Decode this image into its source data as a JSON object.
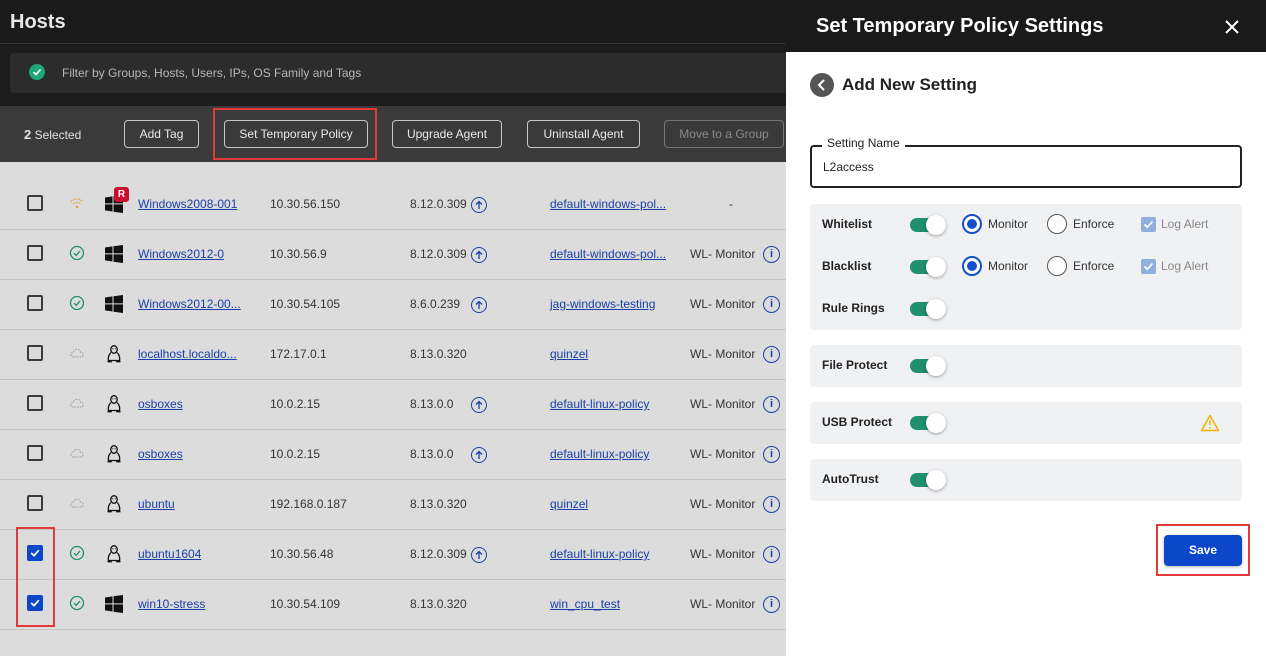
{
  "page": {
    "title": "Hosts"
  },
  "filter": {
    "placeholder": "Filter by Groups, Hosts, Users, IPs, OS Family and Tags"
  },
  "actionbar": {
    "selected_count": "2",
    "selected_label": "Selected",
    "add_tag": "Add Tag",
    "set_temp_policy": "Set Temporary Policy",
    "upgrade_agent": "Upgrade Agent",
    "uninstall_agent": "Uninstall Agent",
    "move_to_group": "Move to a Group"
  },
  "rows": [
    {
      "checked": false,
      "status": "wifi",
      "os": "windows",
      "badge": "R",
      "host": "Windows2008-001",
      "ip": "10.30.56.150",
      "version": "8.12.0.309",
      "upgrade": true,
      "policy": "default-windows-pol...",
      "mode": "",
      "dash": "-"
    },
    {
      "checked": false,
      "status": "ok",
      "os": "windows",
      "host": "Windows2012-0",
      "ip": "10.30.56.9",
      "version": "8.12.0.309",
      "upgrade": true,
      "policy": "default-windows-pol...",
      "mode": "WL- Monitor",
      "dash": ""
    },
    {
      "checked": false,
      "status": "ok",
      "os": "windows",
      "host": "Windows2012-00...",
      "ip": "10.30.54.105",
      "version": "8.6.0.239",
      "upgrade": true,
      "policy": "jag-windows-testing",
      "mode": "WL- Monitor",
      "dash": ""
    },
    {
      "checked": false,
      "status": "cloud",
      "os": "linux",
      "host": "localhost.localdo...",
      "ip": "172.17.0.1",
      "version": "8.13.0.320",
      "upgrade": false,
      "policy": "quinzel",
      "mode": "WL- Monitor",
      "dash": ""
    },
    {
      "checked": false,
      "status": "cloud",
      "os": "linux",
      "host": "osboxes",
      "ip": "10.0.2.15",
      "version": "8.13.0.0",
      "upgrade": true,
      "policy": "default-linux-policy",
      "mode": "WL- Monitor",
      "dash": ""
    },
    {
      "checked": false,
      "status": "cloud",
      "os": "linux",
      "host": "osboxes",
      "ip": "10.0.2.15",
      "version": "8.13.0.0",
      "upgrade": true,
      "policy": "default-linux-policy",
      "mode": "WL- Monitor",
      "dash": ""
    },
    {
      "checked": false,
      "status": "cloud",
      "os": "linux",
      "host": "ubuntu",
      "ip": "192.168.0.187",
      "version": "8.13.0.320",
      "upgrade": false,
      "policy": "quinzel",
      "mode": "WL- Monitor",
      "dash": ""
    },
    {
      "checked": true,
      "status": "ok",
      "os": "linux",
      "host": "ubuntu1604",
      "ip": "10.30.56.48",
      "version": "8.12.0.309",
      "upgrade": true,
      "policy": "default-linux-policy",
      "mode": "WL- Monitor",
      "dash": ""
    },
    {
      "checked": true,
      "status": "ok",
      "os": "windows",
      "host": "win10-stress",
      "ip": "10.30.54.109",
      "version": "8.13.0.320",
      "upgrade": false,
      "policy": "win_cpu_test",
      "mode": "WL- Monitor",
      "dash": ""
    }
  ],
  "panel": {
    "title": "Set Temporary Policy Settings",
    "subtitle": "Add New Setting",
    "setting_name_label": "Setting Name",
    "setting_name_value": "L2access",
    "whitelist": {
      "label": "Whitelist",
      "enabled": true,
      "mode": "Monitor",
      "monitor": "Monitor",
      "enforce": "Enforce",
      "log_alert": "Log Alert"
    },
    "blacklist": {
      "label": "Blacklist",
      "enabled": true,
      "mode": "Monitor",
      "monitor": "Monitor",
      "enforce": "Enforce",
      "log_alert": "Log Alert"
    },
    "rule_rings": {
      "label": "Rule Rings",
      "enabled": true
    },
    "file_protect": {
      "label": "File Protect",
      "enabled": true
    },
    "usb_protect": {
      "label": "USB Protect",
      "enabled": true,
      "warning_icon": "warning-icon"
    },
    "autotrust": {
      "label": "AutoTrust",
      "enabled": true
    },
    "save_label": "Save"
  },
  "colors": {
    "accent": "#0d47c9",
    "toggle": "#1f8f6e",
    "highlight": "#e03a3a",
    "link": "#1a3fa8"
  }
}
